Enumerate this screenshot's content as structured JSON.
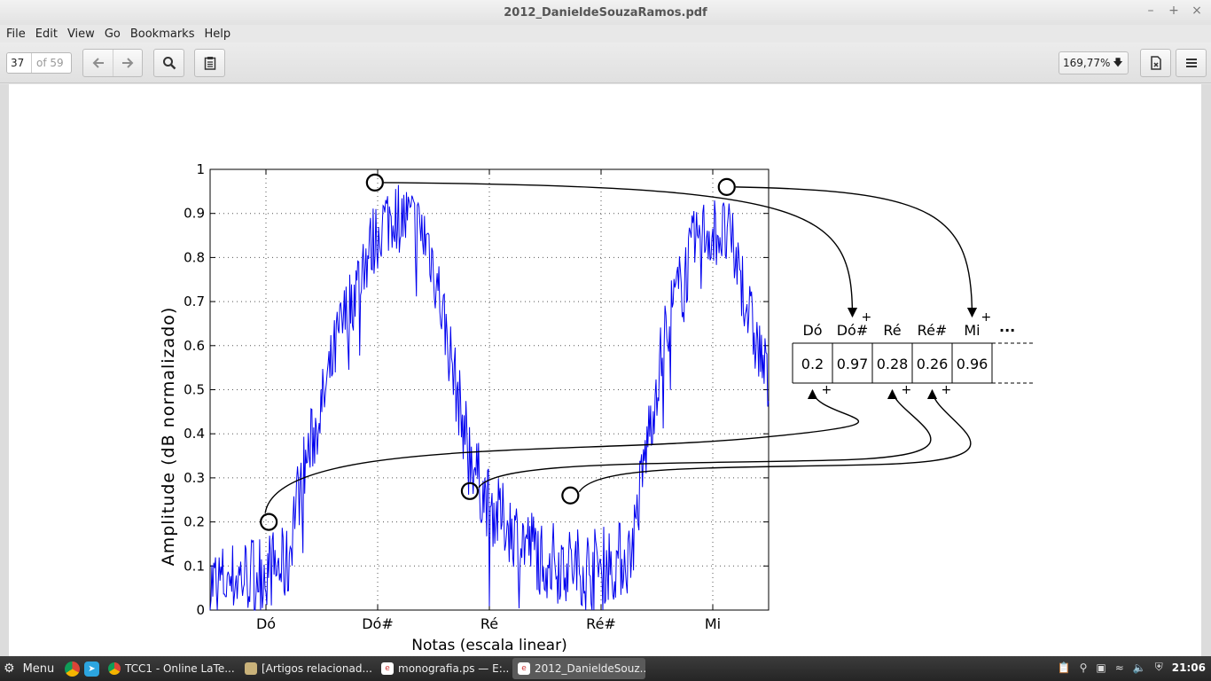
{
  "window": {
    "title": "2012_DanieldeSouzaRamos.pdf"
  },
  "menu": [
    "File",
    "Edit",
    "View",
    "Go",
    "Bookmarks",
    "Help"
  ],
  "toolbar": {
    "page_current": "37",
    "page_total": "of 59",
    "zoom": "169,77%"
  },
  "chart_data": {
    "type": "line",
    "title": "",
    "xlabel": "Notas (escala linear)",
    "ylabel": "Amplitude (dB normalizado)",
    "ylim": [
      0,
      1
    ],
    "xlim": [
      0,
      100
    ],
    "yticks": [
      0,
      0.1,
      0.2,
      0.3,
      0.4,
      0.5,
      0.6,
      0.7,
      0.8,
      0.9,
      1
    ],
    "ytick_labels": [
      "0",
      "0.1",
      "0.2",
      "0.3",
      "0.4",
      "0.5",
      "0.6",
      "0.7",
      "0.8",
      "0.9",
      "1"
    ],
    "xticks": [
      10,
      30,
      50,
      70,
      90
    ],
    "xtick_labels": [
      "Dó",
      "Dó#",
      "Ré",
      "Ré#",
      "Mi"
    ],
    "grid": true,
    "line_color": "#0000ee",
    "envelope": {
      "x": [
        0,
        4,
        9,
        14,
        15,
        17,
        20,
        23,
        26,
        29,
        31,
        33,
        36,
        39,
        41,
        43,
        45,
        47,
        49,
        51,
        53,
        55,
        58,
        60,
        62,
        65,
        67,
        70,
        72,
        75,
        76,
        78,
        80,
        82,
        85,
        87,
        89,
        91,
        93,
        95,
        97,
        98,
        99,
        100
      ],
      "y": [
        0.06,
        0.07,
        0.09,
        0.1,
        0.22,
        0.33,
        0.46,
        0.62,
        0.73,
        0.83,
        0.88,
        0.9,
        0.88,
        0.84,
        0.72,
        0.58,
        0.44,
        0.34,
        0.26,
        0.22,
        0.2,
        0.17,
        0.14,
        0.12,
        0.11,
        0.1,
        0.1,
        0.1,
        0.11,
        0.12,
        0.18,
        0.36,
        0.52,
        0.66,
        0.76,
        0.84,
        0.86,
        0.86,
        0.84,
        0.76,
        0.64,
        0.6,
        0.56,
        0.5
      ]
    },
    "peaks": [
      {
        "x": 10.5,
        "y": 0.2
      },
      {
        "x": 29.5,
        "y": 0.97
      },
      {
        "x": 46.5,
        "y": 0.27
      },
      {
        "x": 64.5,
        "y": 0.26
      },
      {
        "x": 92.5,
        "y": 0.96
      }
    ],
    "table": {
      "headers": [
        "Dó",
        "Dó#",
        "Ré",
        "Ré#",
        "Mi"
      ],
      "values": [
        "0.2",
        "0.97",
        "0.28",
        "0.26",
        "0.96"
      ],
      "ellipsis": "···",
      "plus": "+"
    }
  },
  "taskbar": {
    "menu_label": "Menu",
    "tasks": [
      {
        "label": "TCC1 - Online LaTe...",
        "icon": "chrome-icon"
      },
      {
        "label": "[Artigos relacionad...",
        "icon": "folder-icon"
      },
      {
        "label": "monografia.ps — E:...",
        "icon": "evince-icon"
      },
      {
        "label": "2012_DanieldeSouz...",
        "icon": "evince-icon"
      }
    ],
    "clock": "21:06"
  }
}
